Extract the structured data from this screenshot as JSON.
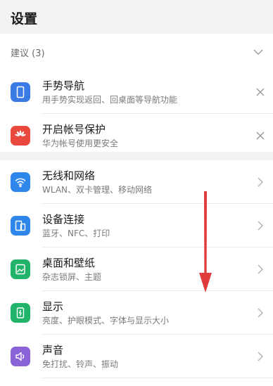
{
  "header": {
    "title": "设置"
  },
  "suggestions": {
    "label": "建议 (3)",
    "items": [
      {
        "title": "手势导航",
        "subtitle": "用手势实现返回、回桌面等导航功能",
        "icon": "gesture-icon",
        "color": "#3a7be4"
      },
      {
        "title": "开启帐号保护",
        "subtitle": "华为帐号使用更安全",
        "icon": "huawei-logo-icon",
        "color": "#e8483d"
      }
    ]
  },
  "settings": {
    "items": [
      {
        "title": "无线和网络",
        "subtitle": "WLAN、双卡管理、移动网络",
        "icon": "wifi-icon",
        "color": "#2f86ea"
      },
      {
        "title": "设备连接",
        "subtitle": "蓝牙、NFC、打印",
        "icon": "device-connect-icon",
        "color": "#2f86ea"
      },
      {
        "title": "桌面和壁纸",
        "subtitle": "杂志锁屏、主题",
        "icon": "wallpaper-icon",
        "color": "#22b36a"
      },
      {
        "title": "显示",
        "subtitle": "亮度、护眼模式、字体与显示大小",
        "icon": "display-icon",
        "color": "#22b36a"
      },
      {
        "title": "声音",
        "subtitle": "免打扰、铃声、振动",
        "icon": "sound-icon",
        "color": "#8a63d8"
      }
    ]
  },
  "annotation": {
    "color": "#e03a3a",
    "icon": "down-arrow-annotation"
  }
}
